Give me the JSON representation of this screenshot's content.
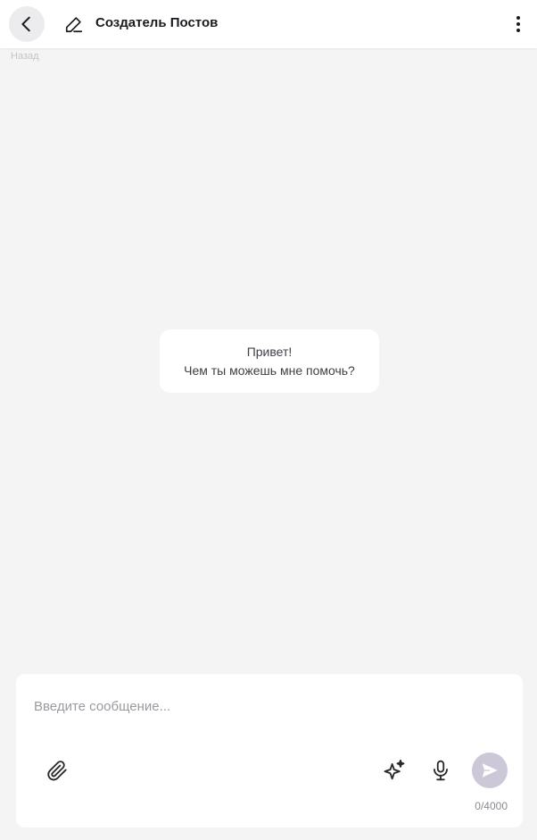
{
  "header": {
    "title": "Создатель Постов",
    "back_tooltip": "Назад"
  },
  "chat": {
    "greeting_line1": "Привет!",
    "greeting_line2": "Чем ты можешь мне помочь?"
  },
  "composer": {
    "placeholder": "Введите сообщение...",
    "value": "",
    "char_count": "0/4000"
  },
  "icons": {
    "back": "chevron-left-icon",
    "edit": "pencil-icon",
    "menu": "more-vertical-icon",
    "attach": "paperclip-icon",
    "sparkle": "sparkle-icon",
    "mic": "microphone-icon",
    "send": "send-icon"
  },
  "colors": {
    "background": "#f4f4f5",
    "surface": "#ffffff",
    "send_button": "#cdc8d8",
    "text_primary": "#1b1b1f"
  }
}
